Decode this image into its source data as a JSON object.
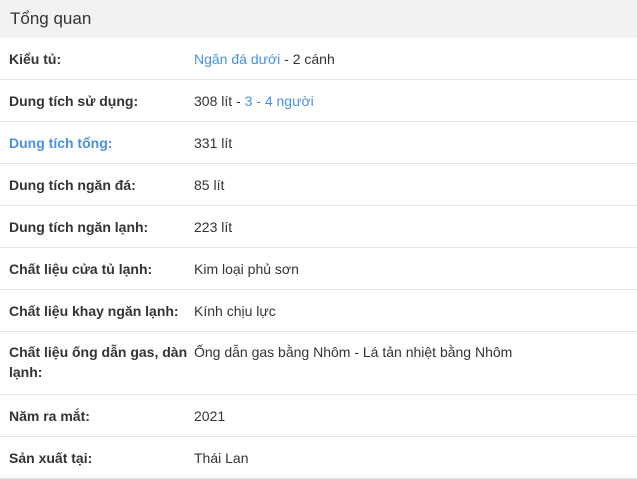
{
  "header": {
    "title": "Tổng quan"
  },
  "rows": [
    {
      "label": "Kiểu tủ:",
      "value_link": "Ngăn đá dưới",
      "value_rest": " - 2 cánh"
    },
    {
      "label": "Dung tích sử dụng:",
      "value_plain": "308 lít - ",
      "value_link": "3 - 4 người"
    },
    {
      "label": "Dung tích tổng:",
      "value_plain": "331 lít"
    },
    {
      "label": "Dung tích ngăn đá:",
      "value_plain": "85 lít"
    },
    {
      "label": "Dung tích ngăn lạnh:",
      "value_plain": "223 lít"
    },
    {
      "label": "Chất liệu cửa tủ lạnh:",
      "value_plain": "Kim loại phủ sơn"
    },
    {
      "label": "Chất liệu khay ngăn lạnh:",
      "value_plain": "Kính chịu lực"
    },
    {
      "label": "Chất liệu ống dẫn gas, dàn lạnh:",
      "value_plain": "Ống dẫn gas bằng Nhôm - Lá tản nhiệt bằng Nhôm"
    },
    {
      "label": "Năm ra mắt:",
      "value_plain": "2021"
    },
    {
      "label": "Sản xuất tại:",
      "value_plain": "Thái Lan"
    }
  ]
}
